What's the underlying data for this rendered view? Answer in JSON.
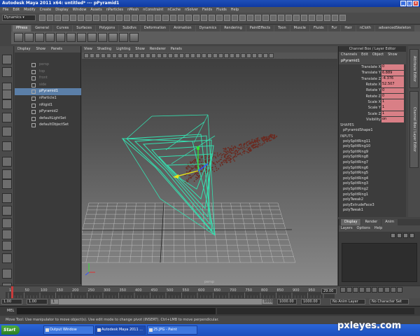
{
  "window": {
    "title": "Autodesk Maya 2011 x64: untitled*  ---  pPyramid1"
  },
  "menubar": [
    "File",
    "Edit",
    "Modify",
    "Create",
    "Display",
    "Window",
    "Assets",
    "nParticles",
    "nMesh",
    "nConstraint",
    "nCache",
    "nSolver",
    "Fields",
    "Fluids",
    "Help"
  ],
  "statusline": {
    "menu_set": "Dynamics"
  },
  "shelf_tabs": [
    "PPress",
    "General",
    "Curves",
    "Surfaces",
    "Polygons",
    "Subdivs",
    "Deformation",
    "Animation",
    "Dynamics",
    "Rendering",
    "PaintEffects",
    "Toon",
    "Muscle",
    "Fluids",
    "Fur",
    "Hair",
    "nCloth",
    "advancedSkeleton"
  ],
  "shelf_active_tab": "PPress",
  "outliner": {
    "menu": [
      "Display",
      "Show",
      "Panels"
    ],
    "items": [
      {
        "label": "persp",
        "state": "dim"
      },
      {
        "label": "top",
        "state": "dim"
      },
      {
        "label": "front",
        "state": "dim"
      },
      {
        "label": "side",
        "state": "dim"
      },
      {
        "label": "pPyramid1",
        "state": "selected"
      },
      {
        "label": "nParticle1",
        "state": "normal"
      },
      {
        "label": "nRigid1",
        "state": "normal"
      },
      {
        "label": "pPyramid2",
        "state": "normal"
      },
      {
        "label": "defaultLightSet",
        "state": "normal"
      },
      {
        "label": "defaultObjectSet",
        "state": "normal"
      }
    ]
  },
  "viewport": {
    "menu": [
      "View",
      "Shading",
      "Lighting",
      "Show",
      "Renderer",
      "Panels"
    ],
    "camera_label": "persp",
    "colors": {
      "wire": "#35e0b0",
      "particles": "#6b2a20",
      "grid": "#c4c4c4",
      "manip_y": "#e6e61a",
      "manip_x": "#e03030",
      "manip_z": "#3050ff"
    }
  },
  "channelbox": {
    "header": "Channel Box / Layer Editor",
    "menu": [
      "Channels",
      "Edit",
      "Object",
      "Show"
    ],
    "object": "pPyramid1",
    "attrs": [
      {
        "label": "Translate X",
        "value": "0"
      },
      {
        "label": "Translate Y",
        "value": "6.889"
      },
      {
        "label": "Translate Z",
        "value": "-4.376"
      },
      {
        "label": "Rotate X",
        "value": "52.507"
      },
      {
        "label": "Rotate Y",
        "value": "0"
      },
      {
        "label": "Rotate Z",
        "value": "0"
      },
      {
        "label": "Scale X",
        "value": "1"
      },
      {
        "label": "Scale Y",
        "value": "1"
      },
      {
        "label": "Scale Z",
        "value": "1"
      },
      {
        "label": "Visibility",
        "value": "on"
      }
    ],
    "shapes_label": "SHAPES",
    "shapes": [
      "pPyramidShape1"
    ],
    "inputs_label": "INPUTS",
    "inputs": [
      "polySplitRing11",
      "polySplitRing10",
      "polySplitRing9",
      "polySplitRing8",
      "polySplitRing7",
      "polySplitRing6",
      "polySplitRing5",
      "polySplitRing4",
      "polySplitRing3",
      "polySplitRing2",
      "polySplitRing1",
      "polyTweak2",
      "polyExtrudeFace3",
      "polyTweak1"
    ]
  },
  "side_tabs": [
    "Attribute Editor",
    "Channel Box / Layer Editor"
  ],
  "layer_editor": {
    "tabs": [
      "Display",
      "Render",
      "Anim"
    ],
    "active_tab": "Display",
    "menu": [
      "Layers",
      "Options",
      "Help"
    ]
  },
  "timeslider": {
    "ticks": [
      "1",
      "50",
      "100",
      "150",
      "200",
      "250",
      "300",
      "350",
      "400",
      "450",
      "500",
      "550",
      "600",
      "650",
      "700",
      "750",
      "800",
      "850",
      "900",
      "950",
      "1000"
    ],
    "current_frame_field": "29.00"
  },
  "range": {
    "start": "1.00",
    "inner_start": "1.00",
    "inner_start_box": "1",
    "end_box": "1000",
    "inner_end": "1000.00",
    "end": "1000.00",
    "anim_layer": "No Anim Layer",
    "char_set": "No Character Set"
  },
  "cmdline": {
    "label": "MEL"
  },
  "helpline": "Move Tool: Use manipulator to move object(s). Use edit mode to change pivot (INSERT). Ctrl+LMB to move perpendicular.",
  "taskbar": {
    "start": "Start",
    "tasks": [
      {
        "label": "Output Window",
        "active": false
      },
      {
        "label": "Autodesk Maya 2011 ...",
        "active": true
      },
      {
        "label": "25.JPG - Paint",
        "active": false
      }
    ]
  },
  "watermark": "pxleyes.com"
}
